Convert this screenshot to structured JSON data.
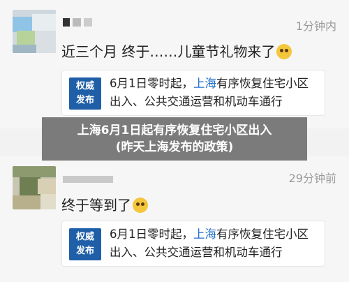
{
  "posts": [
    {
      "time": "1分钟内",
      "message": "近三个月  终于……儿童节礼物来了",
      "emoji": "face-emoji-sad",
      "card": {
        "badge_line1": "权威",
        "badge_line2": "发布",
        "text_before": "6月1日零时起，",
        "text_highlight": "上海",
        "text_after": "有序恢复住宅小区出入、公共交通运营和机动车通行"
      }
    },
    {
      "time": "29分钟前",
      "message": "终于等到了",
      "emoji": "face-emoji-surprised",
      "card": {
        "badge_line1": "权威",
        "badge_line2": "发布",
        "text_before": "6月1日零时起，",
        "text_highlight": "上海",
        "text_after": "有序恢复住宅小区出入、公共交通运营和机动车通行"
      }
    }
  ],
  "overlay": {
    "line1": "上海6月1日起有序恢复住宅小区出入",
    "line2": "(昨天上海发布的政策)"
  },
  "colors": {
    "badge": "#1f5fa8",
    "highlight": "#1f6fc9",
    "overlay": "#5c5c5c"
  }
}
